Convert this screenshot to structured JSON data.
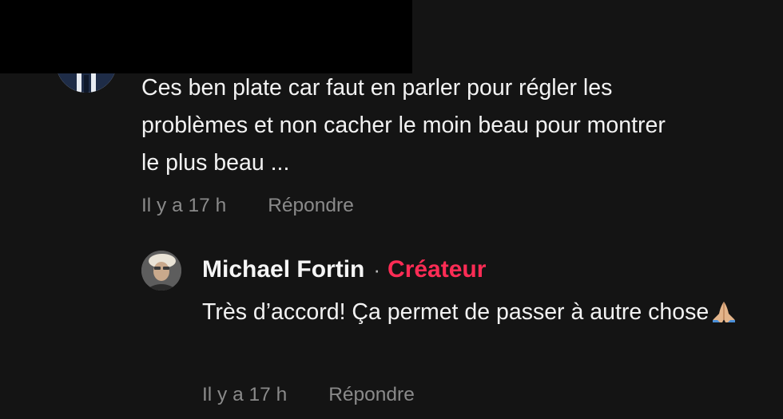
{
  "comment": {
    "text": "Ces ben plate car faut en parler pour régler les\nproblèmes et non cacher le moin beau pour montrer\nle plus beau ...",
    "time": "Il y a 17 h",
    "reply_label": "Répondre"
  },
  "reply": {
    "author": "Michael Fortin",
    "separator": "·",
    "badge": "Créateur",
    "text": "Très d’accord! Ça permet de passer à autre chose",
    "emoji": "folded-hands-icon",
    "time": "Il y a 17 h",
    "reply_label": "Répondre"
  },
  "colors": {
    "background": "#141414",
    "text": "#f2f2f2",
    "meta": "#8a8a8a",
    "creator_accent": "#fe2c55"
  }
}
